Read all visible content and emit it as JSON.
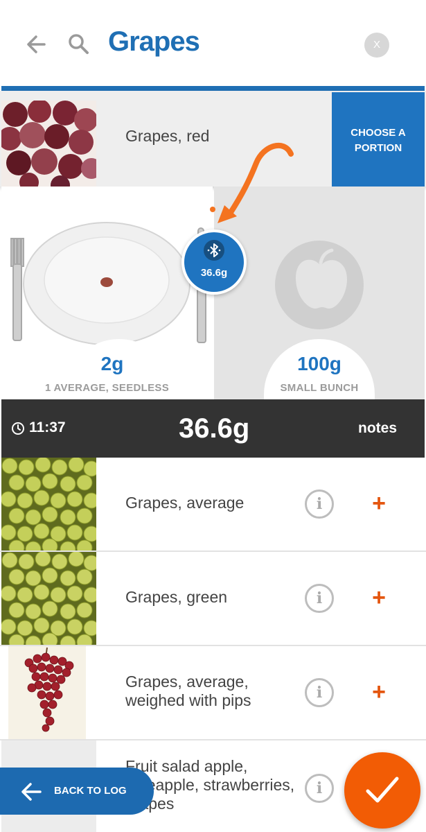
{
  "header": {
    "title": "Grapes",
    "clear_label": "X",
    "accent_color": "#1f6fb4"
  },
  "selected_food": {
    "name": "Grapes, red",
    "choose_portion_label": "CHOOSE A PORTION"
  },
  "portions": [
    {
      "amount": "2g",
      "description": "1 AVERAGE, SEEDLESS"
    },
    {
      "amount": "100g",
      "description": "SMALL BUNCH"
    }
  ],
  "scale": {
    "weight": "36.6g",
    "icon": "bluetooth-icon"
  },
  "time_bar": {
    "time": "11:37",
    "total_weight": "36.6g",
    "notes_label": "notes"
  },
  "results": [
    {
      "name": "Grapes, average",
      "image": "green-grapes",
      "icons": [
        "info-icon",
        "plus-icon"
      ]
    },
    {
      "name": "Grapes, green",
      "image": "green-grapes",
      "icons": [
        "info-icon",
        "plus-icon"
      ]
    },
    {
      "name": "Grapes, average, weighed with pips",
      "image": "red-grape-bunch",
      "icons": [
        "info-icon",
        "plus-icon"
      ]
    },
    {
      "name": "Fruit salad apple, pineapple, strawberries, grapes",
      "image": "fruit-salad",
      "icons": [
        "info-icon"
      ]
    }
  ],
  "footer": {
    "back_to_log_label": "BACK TO LOG",
    "confirm_icon": "check-icon"
  },
  "colors": {
    "brand_blue": "#1f74c0",
    "dark_bar": "#333333",
    "orange": "#f25c05"
  }
}
